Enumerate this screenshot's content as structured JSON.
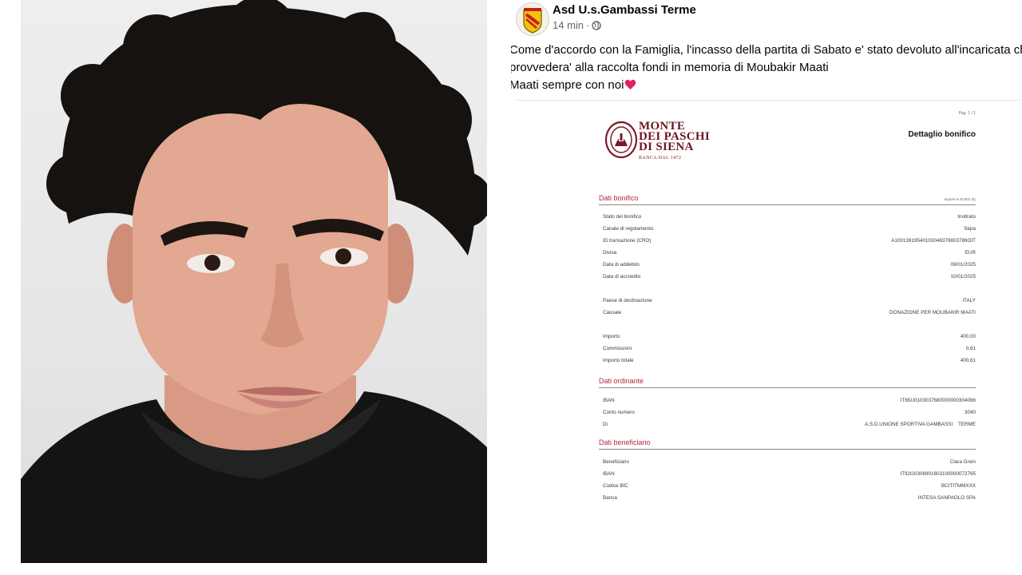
{
  "post": {
    "page_name": "Asd U.s.Gambassi Terme",
    "time": "14 min",
    "separator": "·",
    "lines": [
      "Come d'accordo con la Famiglia, l'incasso della partita di Sabato e' stato devoluto all'incaricata che",
      "provvedera' alla raccolta fondi in memoria di Moubakir Maati",
      "Maati sempre con noi"
    ]
  },
  "document": {
    "page_label": "Pag. 1 / 1",
    "bank_name": [
      "MONTE",
      "DEI PASCHI",
      "DI SIENA"
    ],
    "bank_sub": "BANCA DAL 1472",
    "title": "Dettaglio bonifico",
    "sections": [
      {
        "title": "Dati bonifico",
        "note": "Importi in EURO (€)",
        "rows": [
          {
            "label": "Stato del bonifico",
            "value": "Inoltrato"
          },
          {
            "label": "Canale di regolamento",
            "value": "Sepa"
          },
          {
            "label": "ID transazione (CRO)",
            "value": "A10013919540103048378803788OIT"
          },
          {
            "label": "Divisa",
            "value": "EUR"
          },
          {
            "label": "Data di addebito",
            "value": "09/01/2025"
          },
          {
            "label": "Data di accredito",
            "value": "10/01/2025"
          },
          {
            "label": "Paese di destinazione",
            "value": "ITALY"
          },
          {
            "label": "Causale",
            "value": "DONAZIONE PER MOUBAKIR MAATI"
          },
          {
            "label": "Importo",
            "value": "400,00"
          },
          {
            "label": "Commissioni",
            "value": "0,61"
          },
          {
            "label": "Importo totale",
            "value": "400,61"
          }
        ]
      },
      {
        "title": "Dati ordinante",
        "rows": [
          {
            "label": "IBAN",
            "value": "IT65U0103037680000000304086"
          },
          {
            "label": "Conto numero",
            "value": "3040"
          },
          {
            "label": "Di",
            "value": "A.S.D.UNIONE SPORTIVA GAMBASSI    TERME"
          }
        ]
      },
      {
        "title": "Dati beneficiario",
        "rows": [
          {
            "label": "Beneficiario",
            "value": "Clara Grein"
          },
          {
            "label": "IBAN",
            "value": "IT92G0306901603100000072765"
          },
          {
            "label": "Codice BIC",
            "value": "BCITITMMXXX"
          },
          {
            "label": "Banca",
            "value": "INTESA SANPAOLO SPA"
          }
        ]
      }
    ]
  },
  "colors": {
    "bank_red": "#6e1423",
    "section_red": "#b22a3a",
    "meta_gray": "#65676b",
    "heart": "#e0245e"
  },
  "icons": {
    "avatar": "club-crest-icon",
    "audience": "globe-icon",
    "emoji": "red-heart-icon",
    "bank_logo": "mps-crest-icon"
  }
}
